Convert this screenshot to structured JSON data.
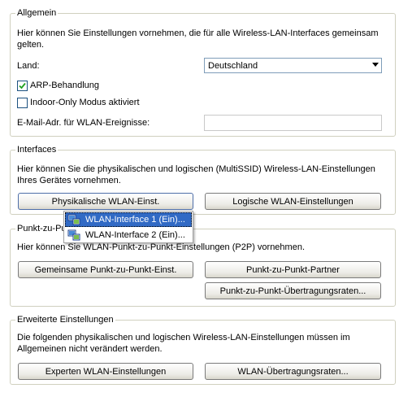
{
  "general": {
    "legend": "Allgemein",
    "description": "Hier können Sie Einstellungen vornehmen, die für alle Wireless-LAN-Interfaces gemeinsam gelten.",
    "country_label": "Land:",
    "country_value": "Deutschland",
    "arp_label": "ARP-Behandlung",
    "arp_checked": true,
    "indoor_label": "Indoor-Only Modus aktiviert",
    "indoor_checked": false,
    "email_label": "E-Mail-Adr. für WLAN-Ereignisse:",
    "email_value": ""
  },
  "interfaces": {
    "legend": "Interfaces",
    "description": "Hier können Sie die physikalischen und logischen (MultiSSID) Wireless-LAN-Einstellungen Ihres Gerätes vornehmen.",
    "physical_button": "Physikalische WLAN-Einst.",
    "logical_button": "Logische WLAN-Einstellungen"
  },
  "popup_menu": {
    "items": [
      {
        "label": "WLAN-Interface 1 (Ein)...",
        "selected": true
      },
      {
        "label": "WLAN-Interface 2 (Ein)...",
        "selected": false
      }
    ]
  },
  "p2p": {
    "legend": "Punkt-zu-Pu",
    "description_visible": "Hier können Sie WLAN-Punkt-zu-Punkt-Einstellungen (P2P) vornehmen.",
    "common_button": "Gemeinsame Punkt-zu-Punkt-Einst.",
    "partner_button": "Punkt-zu-Punkt-Partner",
    "rates_button": "Punkt-zu-Punkt-Übertragungsraten..."
  },
  "advanced": {
    "legend": "Erweiterte Einstellungen",
    "description": "Die folgenden physikalischen und logischen Wireless-LAN-Einstellungen müssen im Allgemeinen nicht verändert werden.",
    "expert_button": "Experten WLAN-Einstellungen",
    "rates_button": "WLAN-Übertragungsraten..."
  },
  "icons": {
    "menu_item_icon": "network-interface-icon",
    "check_icon": "checkmark-icon"
  }
}
